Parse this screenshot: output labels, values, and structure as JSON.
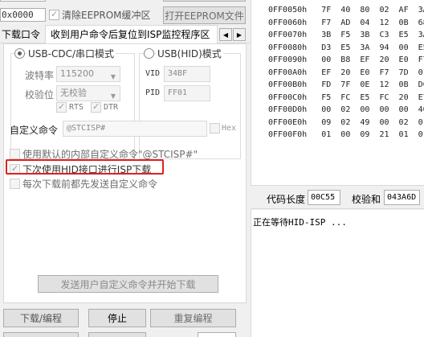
{
  "top": {
    "address_value": "0x0000",
    "clear_eeprom_label": "清除EEPROM缓冲区",
    "open_eeprom_label": "打开EEPROM文件"
  },
  "tabs": {
    "download_label": "下载口令",
    "active_label": "收到用户命令后复位到ISP监控程序区",
    "prev_glyph": "◀",
    "next_glyph": "▶"
  },
  "usb_cdc": {
    "title": "USB-CDC/串口模式",
    "baud_label": "波特率",
    "baud_value": "115200",
    "parity_label": "校验位",
    "parity_value": "无校验",
    "rts_label": "RTS",
    "dtr_label": "DTR"
  },
  "usb_hid": {
    "title": "USB(HID)模式",
    "vid_label": "VID",
    "vid_value": "34BF",
    "pid_label": "PID",
    "pid_value": "FF01"
  },
  "custom_cmd": {
    "label": "自定义命令",
    "value": "@STCISP#",
    "hex_label": "Hex"
  },
  "options": {
    "use_default_label": "使用默认的内部自定义命令\"@STCISP#\"",
    "hid_isp_label": "下次使用HID接口进行ISP下载",
    "send_before_label": "每次下载前都先发送自定义命令"
  },
  "send_cmd_button": "发送用户自定义命令并开始下载",
  "bottom_buttons": {
    "download": "下载/编程",
    "stop": "停止",
    "reprogram": "重复编程"
  },
  "hex_rows": [
    "0FF0050h   7F  40  80  02  AF  3A",
    "0FF0060h   F7  AD  04  12  0B  68",
    "0FF0070h   3B  F5  3B  C3  E5  3A",
    "0FF0080h   D3  E5  3A  94  00  E5",
    "0FF0090h   00  B8  EF  20  E0  F7",
    "0FF00A0h   EF  20  E0  F7  7D  01",
    "0FF00B0h   FD  7F  0E  12  0B  DC",
    "0FF00C0h   F5  FC  E5  FC  20  E7",
    "0FF00D0h   00  02  00  00  00  40",
    "0FF00E0h   09  02  49  00  02  01",
    "0FF00F0h   01  00  09  21  01  01"
  ],
  "info": {
    "code_length_label": "代码长度",
    "code_length_value": "00C55",
    "checksum_label": "校验和",
    "checksum_value": "043A6D"
  },
  "status_text": "正在等待HID-ISP ..."
}
